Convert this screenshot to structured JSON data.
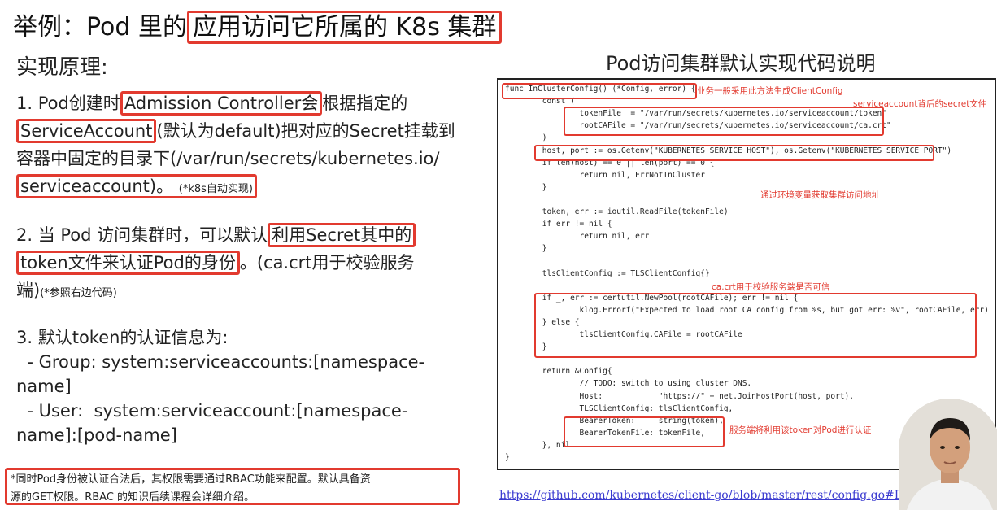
{
  "title": {
    "prefix": "举例：Pod 里的",
    "highlight": "应用访问它所属的 K8s 集群"
  },
  "left": {
    "heading": "实现原理:",
    "p1": {
      "a": "1. Pod创建时",
      "b": "Admission Controller会",
      "c": "根据指定的",
      "d": "ServiceAccount",
      "e": "(默认为default)把对应的Secret挂载到",
      "f": "容器中固定的目录下(/var/run/secrets/kubernetes.io/",
      "g": "serviceaccount)。",
      "h": "(*k8s自动实现)"
    },
    "p2": {
      "a": "2. 当 Pod 访问集群时，可以默认",
      "b": "利用Secret其中的",
      "c": "token文件来认证Pod的身份",
      "d": "。(ca.crt用于校验服务",
      "e": "端)",
      "f": "(*参照右边代码)"
    },
    "p3": {
      "a": "3. 默认token的认证信息为:",
      "b": "  - Group: system:serviceaccounts:[namespace-",
      "c": "name]",
      "d": "  - User:  system:serviceaccount:[namespace-",
      "e": "name]:[pod-name]"
    },
    "note": {
      "line1": "*同时Pod身份被认证合法后，其权限需要通过RBAC功能来配置。默认具备资",
      "line2": "源的GET权限。RBAC 的知识后续课程会详细介绍。"
    }
  },
  "right": {
    "title": "Pod访问集群默认实现代码说明",
    "code": [
      "func InClusterConfig() (*Config, error) {",
      "        const (",
      "                tokenFile  = \"/var/run/secrets/kubernetes.io/serviceaccount/token\"",
      "                rootCAFile = \"/var/run/secrets/kubernetes.io/serviceaccount/ca.crt\"",
      "        )",
      "        host, port := os.Getenv(\"KUBERNETES_SERVICE_HOST\"), os.Getenv(\"KUBERNETES_SERVICE_PORT\")",
      "        if len(host) == 0 || len(port) == 0 {",
      "                return nil, ErrNotInCluster",
      "        }",
      "",
      "        token, err := ioutil.ReadFile(tokenFile)",
      "        if err != nil {",
      "                return nil, err",
      "        }",
      "",
      "        tlsClientConfig := TLSClientConfig{}",
      "",
      "        if _, err := certutil.NewPool(rootCAFile); err != nil {",
      "                klog.Errorf(\"Expected to load root CA config from %s, but got err: %v\", rootCAFile, err)",
      "        } else {",
      "                tlsClientConfig.CAFile = rootCAFile",
      "        }",
      "",
      "        return &Config{",
      "                // TODO: switch to using cluster DNS.",
      "                Host:            \"https://\" + net.JoinHostPort(host, port),",
      "                TLSClientConfig: tlsClientConfig,",
      "                BearerToken:     string(token),",
      "                BearerTokenFile: tokenFile,",
      "        }, nil",
      "}"
    ],
    "annotations": {
      "a1": "业务一般采用此方法生成ClientConfig",
      "a2": "serviceaccount背后的secret文件",
      "a3": "通过环境变量获取集群访问地址",
      "a4": "ca.crt用于校验服务端是否可信",
      "a5": "服务端将利用该token对Pod进行认证"
    },
    "link": "https://github.com/kubernetes/client-go/blob/master/rest/config.go#L399:6"
  },
  "colors": {
    "accent": "#e23a2f",
    "link": "#3a3ad0",
    "keyword": "#3a54c4"
  }
}
